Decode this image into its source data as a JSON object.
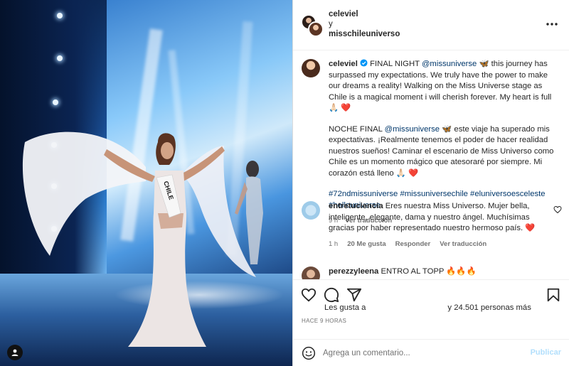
{
  "post": {
    "author": "celeviel",
    "conjunction": "y",
    "collaborator": "misschileuniverso",
    "sash_text": "CHILE"
  },
  "caption": {
    "username": "celeviel",
    "paragraph1_before": "FINAL NIGHT ",
    "mention1": "@missuniverse",
    "paragraph1_after": " 🦋 this journey has surpassed my expectations. We truly have the power to make our dreams a reality! Walking on the Miss Universe stage as Chile is a magical moment i will cherish forever. My heart is full 🙏🏻 ❤️",
    "paragraph2_before": "NOCHE FINAL ",
    "mention2": "@missuniverse",
    "paragraph2_after": " 🦋 este viaje ha superado mis expectativas. ¡Realmente tenemos el poder de hacer realidad nuestros sueños! Caminar el escenario de Miss Universo como Chile es un momento mágico que atesoraré por siempre. Mi corazón está lleno 🙏🏻 ❤️",
    "hashtags": "#72ndmissuniverse #missuniversechile #eluniversoesceleste #hellouniverse",
    "time": "9 h",
    "translate": "Ver traducción"
  },
  "comments": [
    {
      "username": "entretuciencia",
      "text": "Eres nuestra Miss Universo. Mujer bella, inteligente, elegante, dama y nuestro ángel. Muchísimas gracias por haber representado nuestro hermoso país. ❤️",
      "time": "1 h",
      "likes": "20 Me gusta",
      "reply": "Responder",
      "translate": "Ver traducción"
    },
    {
      "username": "perezzyleena",
      "text": "ENTRO AL TOPP 🔥🔥🔥"
    }
  ],
  "footer": {
    "likes_prefix": "Les gusta a",
    "likes_suffix": "y 24.501 personas más",
    "timestamp": "HACE 9 HORAS",
    "comment_placeholder": "Agrega un comentario...",
    "post_label": "Publicar"
  },
  "colors": {
    "link": "#00376b",
    "verified": "#0095f6",
    "heart": "#ed1c24",
    "post_disabled": "#b2dffc"
  },
  "icons": [
    "more-icon",
    "verified-icon",
    "heart-icon",
    "comment-icon",
    "share-icon",
    "bookmark-icon",
    "emoji-icon"
  ]
}
